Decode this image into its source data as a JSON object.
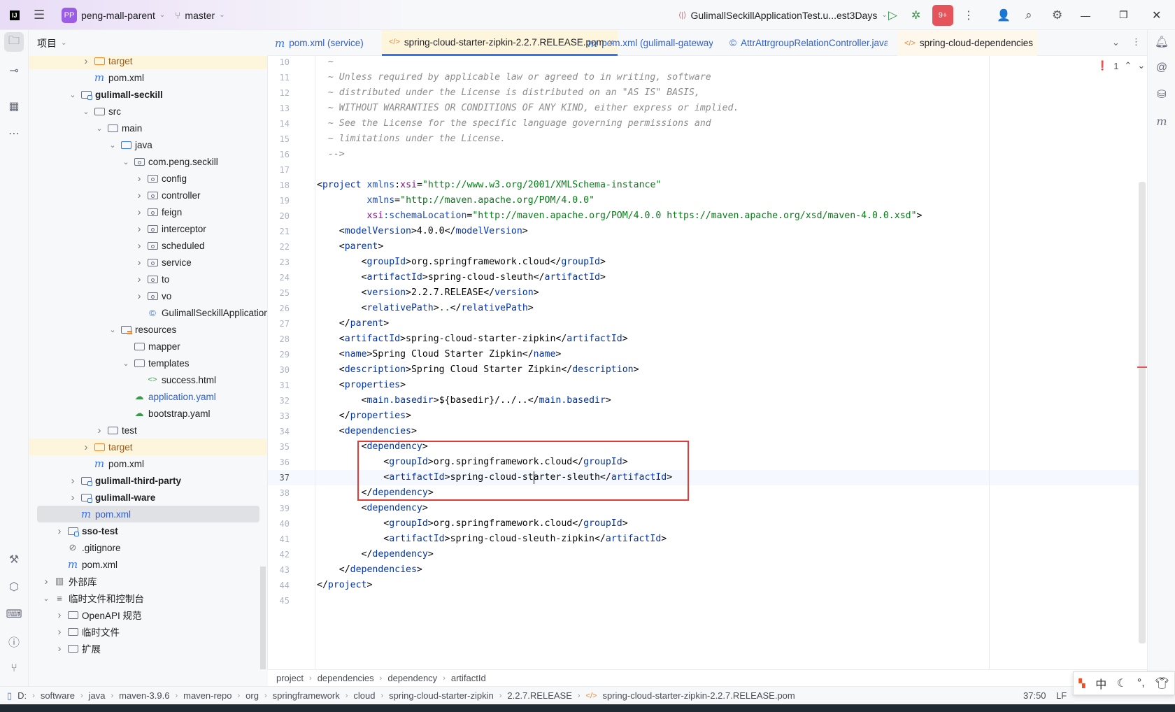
{
  "titlebar": {
    "project_badge": "PP",
    "project_name": "peng-mall-parent",
    "branch": "master",
    "run_config": "GulimallSeckillApplicationTest.u...est3Days",
    "notification_count": "9+",
    "accent": "#3574f0"
  },
  "project_panel": {
    "title": "项目",
    "tree": [
      {
        "label": "target",
        "depth": 3,
        "arrow": "collapsed",
        "icon": "folder-orange",
        "highlight": true
      },
      {
        "label": "pom.xml",
        "depth": 3,
        "arrow": "none",
        "icon": "maven"
      },
      {
        "label": "gulimall-seckill",
        "depth": 2,
        "arrow": "expanded",
        "icon": "module",
        "bold": true
      },
      {
        "label": "src",
        "depth": 3,
        "arrow": "expanded",
        "icon": "folder"
      },
      {
        "label": "main",
        "depth": 4,
        "arrow": "expanded",
        "icon": "folder"
      },
      {
        "label": "java",
        "depth": 5,
        "arrow": "expanded",
        "icon": "folder-blue"
      },
      {
        "label": "com.peng.seckill",
        "depth": 6,
        "arrow": "expanded",
        "icon": "package"
      },
      {
        "label": "config",
        "depth": 7,
        "arrow": "collapsed",
        "icon": "package"
      },
      {
        "label": "controller",
        "depth": 7,
        "arrow": "collapsed",
        "icon": "package"
      },
      {
        "label": "feign",
        "depth": 7,
        "arrow": "collapsed",
        "icon": "package"
      },
      {
        "label": "interceptor",
        "depth": 7,
        "arrow": "collapsed",
        "icon": "package"
      },
      {
        "label": "scheduled",
        "depth": 7,
        "arrow": "collapsed",
        "icon": "package"
      },
      {
        "label": "service",
        "depth": 7,
        "arrow": "collapsed",
        "icon": "package"
      },
      {
        "label": "to",
        "depth": 7,
        "arrow": "collapsed",
        "icon": "package"
      },
      {
        "label": "vo",
        "depth": 7,
        "arrow": "collapsed",
        "icon": "package"
      },
      {
        "label": "GulimallSeckillApplication",
        "depth": 7,
        "arrow": "none",
        "icon": "spring-class"
      },
      {
        "label": "resources",
        "depth": 5,
        "arrow": "expanded",
        "icon": "resources"
      },
      {
        "label": "mapper",
        "depth": 6,
        "arrow": "none",
        "icon": "folder"
      },
      {
        "label": "templates",
        "depth": 6,
        "arrow": "expanded",
        "icon": "folder"
      },
      {
        "label": "success.html",
        "depth": 7,
        "arrow": "none",
        "icon": "html"
      },
      {
        "label": "application.yaml",
        "depth": 6,
        "arrow": "none",
        "icon": "yaml",
        "blue": true
      },
      {
        "label": "bootstrap.yaml",
        "depth": 6,
        "arrow": "none",
        "icon": "yaml"
      },
      {
        "label": "test",
        "depth": 4,
        "arrow": "collapsed",
        "icon": "folder"
      },
      {
        "label": "target",
        "depth": 3,
        "arrow": "collapsed",
        "icon": "folder-orange",
        "highlight": true
      },
      {
        "label": "pom.xml",
        "depth": 3,
        "arrow": "none",
        "icon": "maven"
      },
      {
        "label": "gulimall-third-party",
        "depth": 2,
        "arrow": "collapsed",
        "icon": "module",
        "bold": true
      },
      {
        "label": "gulimall-ware",
        "depth": 2,
        "arrow": "collapsed",
        "icon": "module",
        "bold": true
      },
      {
        "label": "pom.xml",
        "depth": 2,
        "arrow": "none",
        "icon": "maven",
        "selected": true,
        "blue": true
      },
      {
        "label": "sso-test",
        "depth": 1,
        "arrow": "collapsed",
        "icon": "module",
        "bold": true
      },
      {
        "label": ".gitignore",
        "depth": 1,
        "arrow": "none",
        "icon": "ignore"
      },
      {
        "label": "pom.xml",
        "depth": 1,
        "arrow": "none",
        "icon": "maven"
      },
      {
        "label": "外部库",
        "depth": 0,
        "arrow": "collapsed",
        "icon": "library"
      },
      {
        "label": "临时文件和控制台",
        "depth": 0,
        "arrow": "expanded",
        "icon": "scratches"
      },
      {
        "label": "OpenAPI 规范",
        "depth": 1,
        "arrow": "collapsed",
        "icon": "folder"
      },
      {
        "label": "临时文件",
        "depth": 1,
        "arrow": "collapsed",
        "icon": "folder"
      },
      {
        "label": "扩展",
        "depth": 1,
        "arrow": "collapsed",
        "icon": "folder"
      }
    ]
  },
  "tabs": [
    {
      "label": "pom.xml (service)",
      "icon": "maven"
    },
    {
      "label": "spring-cloud-starter-zipkin-2.2.7.RELEASE.pom",
      "icon": "xml",
      "active": true,
      "closable": true
    },
    {
      "label": "pom.xml (gulimall-gateway)",
      "icon": "maven"
    },
    {
      "label": "AttrAttrgroupRelationController.java",
      "icon": "class"
    },
    {
      "label": "spring-cloud-dependencies",
      "icon": "xml"
    }
  ],
  "editor": {
    "problems_count": "1",
    "current_line": 37,
    "lines": [
      {
        "n": 10,
        "t": [
          [
            "c",
            "  ~"
          ]
        ]
      },
      {
        "n": 11,
        "t": [
          [
            "c",
            "  ~ Unless required by applicable law or agreed to in writing, software"
          ]
        ]
      },
      {
        "n": 12,
        "t": [
          [
            "c",
            "  ~ distributed under the License is distributed on an \"AS IS\" BASIS,"
          ]
        ]
      },
      {
        "n": 13,
        "t": [
          [
            "c",
            "  ~ WITHOUT WARRANTIES OR CONDITIONS OF ANY KIND, either express or implied."
          ]
        ]
      },
      {
        "n": 14,
        "t": [
          [
            "c",
            "  ~ See the License for the specific language governing permissions and"
          ]
        ]
      },
      {
        "n": 15,
        "t": [
          [
            "c",
            "  ~ limitations under the License."
          ]
        ]
      },
      {
        "n": 16,
        "t": [
          [
            "c",
            "  -->"
          ]
        ]
      },
      {
        "n": 17,
        "t": []
      },
      {
        "n": 18,
        "t": [
          [
            "b",
            "<"
          ],
          [
            "t",
            "project "
          ],
          [
            "a",
            "xmlns"
          ],
          [
            "b",
            ":"
          ],
          [
            "n",
            "xsi"
          ],
          [
            "b",
            "="
          ],
          [
            "s",
            "\"http://www.w3.org/2001/XMLSchema-instance\""
          ]
        ]
      },
      {
        "n": 19,
        "t": [
          [
            "x",
            "         "
          ],
          [
            "a",
            "xmlns"
          ],
          [
            "b",
            "="
          ],
          [
            "s",
            "\"http://maven.apache.org/POM/4.0.0\""
          ]
        ]
      },
      {
        "n": 20,
        "t": [
          [
            "x",
            "         "
          ],
          [
            "n",
            "xsi"
          ],
          [
            "a",
            ":schemaLocation"
          ],
          [
            "b",
            "="
          ],
          [
            "s",
            "\"http://maven.apache.org/POM/4.0.0 https://maven.apache.org/xsd/maven-4.0.0.xsd\""
          ],
          [
            "b",
            ">"
          ]
        ]
      },
      {
        "n": 21,
        "t": [
          [
            "x",
            "    <"
          ],
          [
            "t",
            "modelVersion"
          ],
          [
            "b",
            ">4.0.0</"
          ],
          [
            "t",
            "modelVersion"
          ],
          [
            "b",
            ">"
          ]
        ]
      },
      {
        "n": 22,
        "t": [
          [
            "x",
            "    <"
          ],
          [
            "t",
            "parent"
          ],
          [
            "b",
            ">"
          ]
        ]
      },
      {
        "n": 23,
        "t": [
          [
            "x",
            "        <"
          ],
          [
            "t",
            "groupId"
          ],
          [
            "b",
            ">org.springframework.cloud</"
          ],
          [
            "t",
            "groupId"
          ],
          [
            "b",
            ">"
          ]
        ]
      },
      {
        "n": 24,
        "t": [
          [
            "x",
            "        <"
          ],
          [
            "t",
            "artifactId"
          ],
          [
            "b",
            ">spring-cloud-sleuth</"
          ],
          [
            "t",
            "artifactId"
          ],
          [
            "b",
            ">"
          ]
        ]
      },
      {
        "n": 25,
        "t": [
          [
            "x",
            "        <"
          ],
          [
            "t",
            "version"
          ],
          [
            "b",
            ">2.2.7.RELEASE</"
          ],
          [
            "t",
            "version"
          ],
          [
            "b",
            ">"
          ]
        ]
      },
      {
        "n": 26,
        "t": [
          [
            "x",
            "        <"
          ],
          [
            "t",
            "relativePath"
          ],
          [
            "b",
            ">"
          ],
          [
            "e",
            ".."
          ],
          [
            "b",
            "</"
          ],
          [
            "t",
            "relativePath"
          ],
          [
            "b",
            ">"
          ]
        ]
      },
      {
        "n": 27,
        "t": [
          [
            "x",
            "    </"
          ],
          [
            "t",
            "parent"
          ],
          [
            "b",
            ">"
          ]
        ]
      },
      {
        "n": 28,
        "t": [
          [
            "x",
            "    <"
          ],
          [
            "t",
            "artifactId"
          ],
          [
            "b",
            ">spring-cloud-starter-zipkin</"
          ],
          [
            "t",
            "artifactId"
          ],
          [
            "b",
            ">"
          ]
        ]
      },
      {
        "n": 29,
        "t": [
          [
            "x",
            "    <"
          ],
          [
            "t",
            "name"
          ],
          [
            "b",
            ">Spring Cloud Starter Zipkin</"
          ],
          [
            "t",
            "name"
          ],
          [
            "b",
            ">"
          ]
        ]
      },
      {
        "n": 30,
        "t": [
          [
            "x",
            "    <"
          ],
          [
            "t",
            "description"
          ],
          [
            "b",
            ">Spring Cloud Starter Zipkin</"
          ],
          [
            "t",
            "description"
          ],
          [
            "b",
            ">"
          ]
        ]
      },
      {
        "n": 31,
        "t": [
          [
            "x",
            "    <"
          ],
          [
            "t",
            "properties"
          ],
          [
            "b",
            ">"
          ]
        ]
      },
      {
        "n": 32,
        "t": [
          [
            "x",
            "        <"
          ],
          [
            "t",
            "main.basedir"
          ],
          [
            "b",
            ">${basedir}/../..</"
          ],
          [
            "t",
            "main.basedir"
          ],
          [
            "b",
            ">"
          ]
        ]
      },
      {
        "n": 33,
        "t": [
          [
            "x",
            "    </"
          ],
          [
            "t",
            "properties"
          ],
          [
            "b",
            ">"
          ]
        ]
      },
      {
        "n": 34,
        "t": [
          [
            "x",
            "    <"
          ],
          [
            "t",
            "dependencies"
          ],
          [
            "b",
            ">"
          ]
        ]
      },
      {
        "n": 35,
        "t": [
          [
            "x",
            "        <"
          ],
          [
            "t",
            "dependency"
          ],
          [
            "b",
            ">"
          ]
        ]
      },
      {
        "n": 36,
        "t": [
          [
            "x",
            "            <"
          ],
          [
            "t",
            "groupId"
          ],
          [
            "b",
            ">org.springframework.cloud</"
          ],
          [
            "t",
            "groupId"
          ],
          [
            "b",
            ">"
          ]
        ]
      },
      {
        "n": 37,
        "t": [
          [
            "x",
            "            <"
          ],
          [
            "t",
            "artifactId"
          ],
          [
            "b",
            ">spring-cloud-starter-sleuth</"
          ],
          [
            "t",
            "artifactId"
          ],
          [
            "b",
            ">"
          ]
        ]
      },
      {
        "n": 38,
        "t": [
          [
            "x",
            "        </"
          ],
          [
            "t",
            "dependency"
          ],
          [
            "b",
            ">"
          ]
        ]
      },
      {
        "n": 39,
        "t": [
          [
            "x",
            "        <"
          ],
          [
            "t",
            "dependency"
          ],
          [
            "b",
            ">"
          ]
        ]
      },
      {
        "n": 40,
        "t": [
          [
            "x",
            "            <"
          ],
          [
            "t",
            "groupId"
          ],
          [
            "b",
            ">org.springframework.cloud</"
          ],
          [
            "t",
            "groupId"
          ],
          [
            "b",
            ">"
          ]
        ]
      },
      {
        "n": 41,
        "t": [
          [
            "x",
            "            <"
          ],
          [
            "t",
            "artifactId"
          ],
          [
            "b",
            ">spring-cloud-sleuth-zipkin</"
          ],
          [
            "t",
            "artifactId"
          ],
          [
            "b",
            ">"
          ]
        ]
      },
      {
        "n": 42,
        "t": [
          [
            "x",
            "        </"
          ],
          [
            "t",
            "dependency"
          ],
          [
            "b",
            ">"
          ]
        ]
      },
      {
        "n": 43,
        "t": [
          [
            "x",
            "    </"
          ],
          [
            "t",
            "dependencies"
          ],
          [
            "b",
            ">"
          ]
        ]
      },
      {
        "n": 44,
        "t": [
          [
            "b",
            "</"
          ],
          [
            "t",
            "project"
          ],
          [
            "b",
            ">"
          ]
        ]
      },
      {
        "n": 45,
        "t": []
      }
    ]
  },
  "editor_breadcrumbs": [
    "project",
    "dependencies",
    "dependency",
    "artifactId"
  ],
  "status": {
    "path": [
      "D:",
      "software",
      "java",
      "maven-3.9.6",
      "maven-repo",
      "org",
      "springframework",
      "cloud",
      "spring-cloud-starter-zipkin",
      "2.2.7.RELEASE",
      "spring-cloud-starter-zipkin-2.2.7.RELEASE.pom"
    ],
    "position": "37:50",
    "line_separator": "LF"
  },
  "ime": {
    "mode": "中",
    "punct": "°,"
  }
}
